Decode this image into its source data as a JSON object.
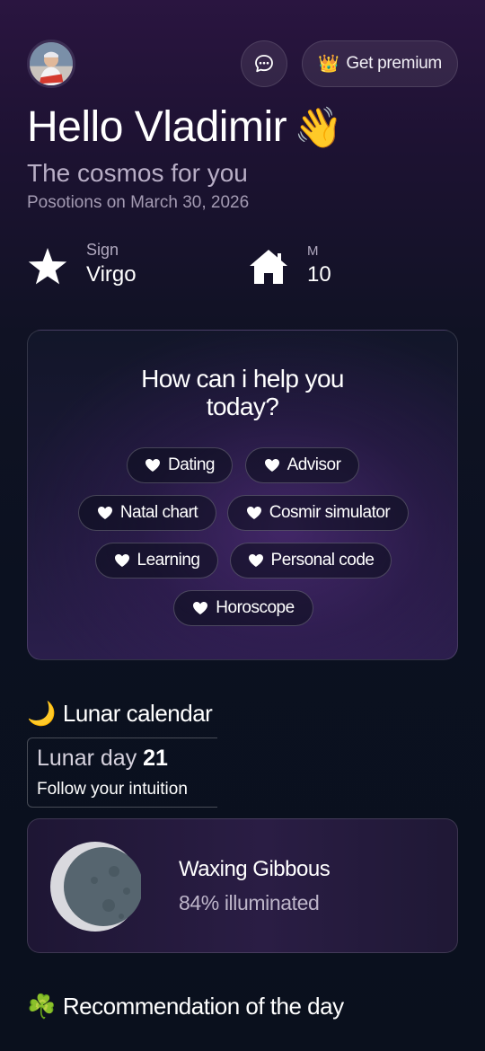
{
  "header": {
    "avatar_alt": "User avatar",
    "premium_label": "Get premium",
    "premium_emoji": "👑"
  },
  "greeting": {
    "text": "Hello Vladimir",
    "emoji": "👋",
    "subtitle": "The cosmos for you",
    "positions": "Posotions on March 30, 2026"
  },
  "stats": {
    "sign": {
      "label": "Sign",
      "value": "Virgo",
      "icon": "star-icon"
    },
    "house": {
      "label": "M",
      "value": "10",
      "icon": "house-icon"
    }
  },
  "help": {
    "title": "How can i help you today?",
    "chips": [
      "Dating",
      "Advisor",
      "Natal chart",
      "Cosmir simulator",
      "Learning",
      "Personal code",
      "Horoscope"
    ]
  },
  "lunar": {
    "emoji": "🌙",
    "title": "Lunar calendar",
    "day_label": "Lunar day",
    "day_number": "21",
    "tip": "Follow your intuition",
    "phase": "Waxing Gibbous",
    "illumination": "84% illuminated"
  },
  "recommendation": {
    "emoji": "☘️",
    "title": "Recommendation of the day"
  },
  "colors": {
    "accent_purple": "#2a1d44",
    "background_dark": "#0b1120",
    "text_muted": "#b8aec6"
  }
}
